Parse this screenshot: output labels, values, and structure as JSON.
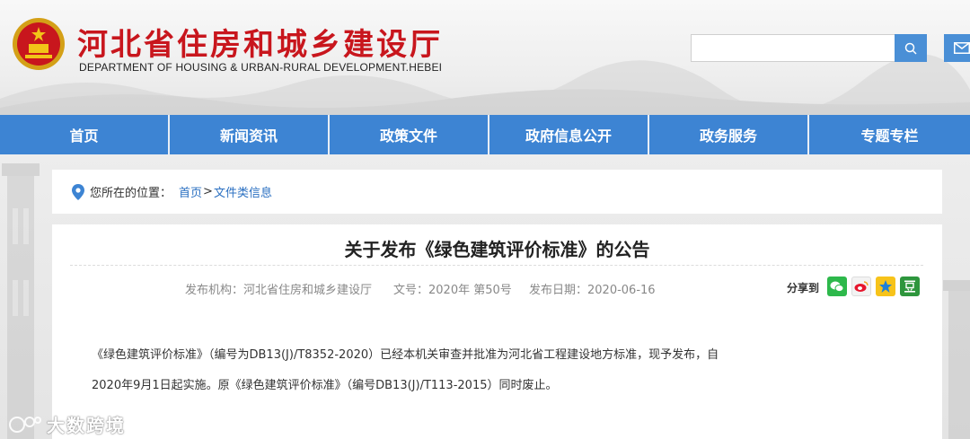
{
  "header": {
    "title": "河北省住房和城乡建设厅",
    "subtitle": "DEPARTMENT OF HOUSING & URBAN-RURAL DEVELOPMENT.HEBEI",
    "search_placeholder": ""
  },
  "nav": {
    "items": [
      {
        "label": "首页"
      },
      {
        "label": "新闻资讯"
      },
      {
        "label": "政策文件"
      },
      {
        "label": "政府信息公开"
      },
      {
        "label": "政务服务"
      },
      {
        "label": "专题专栏"
      }
    ]
  },
  "breadcrumb": {
    "prefix": "您所在的位置：",
    "home": "首页",
    "separator": ">",
    "current": "文件类信息"
  },
  "article": {
    "title": "关于发布《绿色建筑评价标准》的公告",
    "publisher": "发布机构：河北省住房和城乡建设厅",
    "doc_number": "文号：2020年 第50号",
    "publish_date": "发布日期：2020-06-16",
    "share_label": "分享到",
    "share_icons": [
      "wechat-icon",
      "weibo-icon",
      "qzone-icon",
      "douban-icon"
    ],
    "paragraph_line1": "《绿色建筑评价标准》（编号为DB13(J)/T8352-2020）已经本机关审查并批准为河北省工程建设地方标准，现予发布，自",
    "paragraph_line2": "2020年9月1日起实施。原《绿色建筑评价标准》（编号DB13(J)/T113-2015）同时废止。"
  },
  "watermark": {
    "text": "大数跨境"
  },
  "colors": {
    "brand_red": "#c8161d",
    "nav_blue": "#3d84d3",
    "link_blue": "#2a6fc1"
  }
}
